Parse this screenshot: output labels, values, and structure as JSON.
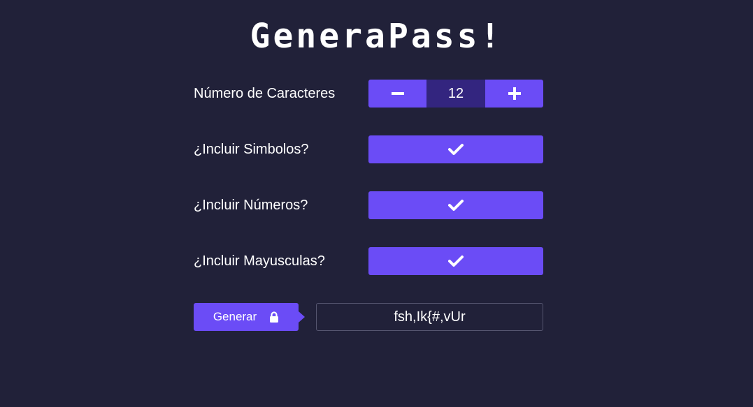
{
  "app": {
    "title": "GeneraPass!"
  },
  "settings": {
    "length": {
      "label": "Número de Caracteres",
      "value": "12",
      "decrement_icon": "minus-icon",
      "increment_icon": "plus-icon"
    },
    "symbols": {
      "label": "¿Incluir Simbolos?",
      "checked": true,
      "icon": "check-icon"
    },
    "numbers": {
      "label": "¿Incluir Números?",
      "checked": true,
      "icon": "check-icon"
    },
    "uppercase": {
      "label": "¿Incluir Mayusculas?",
      "checked": true,
      "icon": "check-icon"
    }
  },
  "generate": {
    "button_label": "Generar",
    "button_icon": "lock-icon",
    "password": "fsh,Ik{#,vUr"
  },
  "colors": {
    "background": "#212139",
    "accent": "#6b4cf6",
    "accent_dark": "#33257f",
    "text": "#ffffff"
  }
}
